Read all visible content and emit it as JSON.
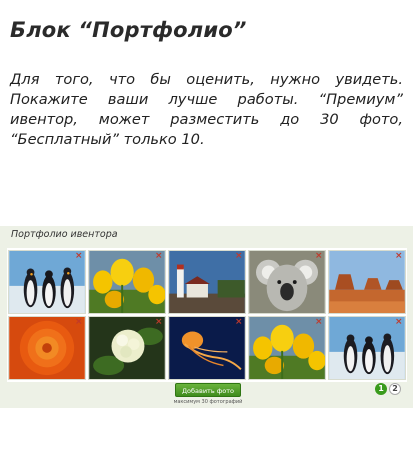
{
  "header": {
    "title": "Блок “Портфолио”"
  },
  "intro": {
    "text": "Для того, что бы оценить, нужно увидеть. Покажите ваши лучше работы. “Премиум” ивентор, может разместить до 30 фото, “Бесплатный” только 10."
  },
  "portfolio": {
    "title": "Портфолио ивентора",
    "delete_icon": "×",
    "photos": [
      {
        "subject": "penguins"
      },
      {
        "subject": "tulips"
      },
      {
        "subject": "lighthouse"
      },
      {
        "subject": "koala"
      },
      {
        "subject": "desert"
      },
      {
        "subject": "chrysanthemum"
      },
      {
        "subject": "hydrangeas"
      },
      {
        "subject": "jellyfish"
      },
      {
        "subject": "tulips"
      },
      {
        "subject": "penguins"
      }
    ],
    "add_button": "Добавить фото",
    "max_note": "максимум 30 фотографий",
    "pages": [
      "1",
      "2"
    ],
    "accent_color": "#3a9b1c"
  }
}
